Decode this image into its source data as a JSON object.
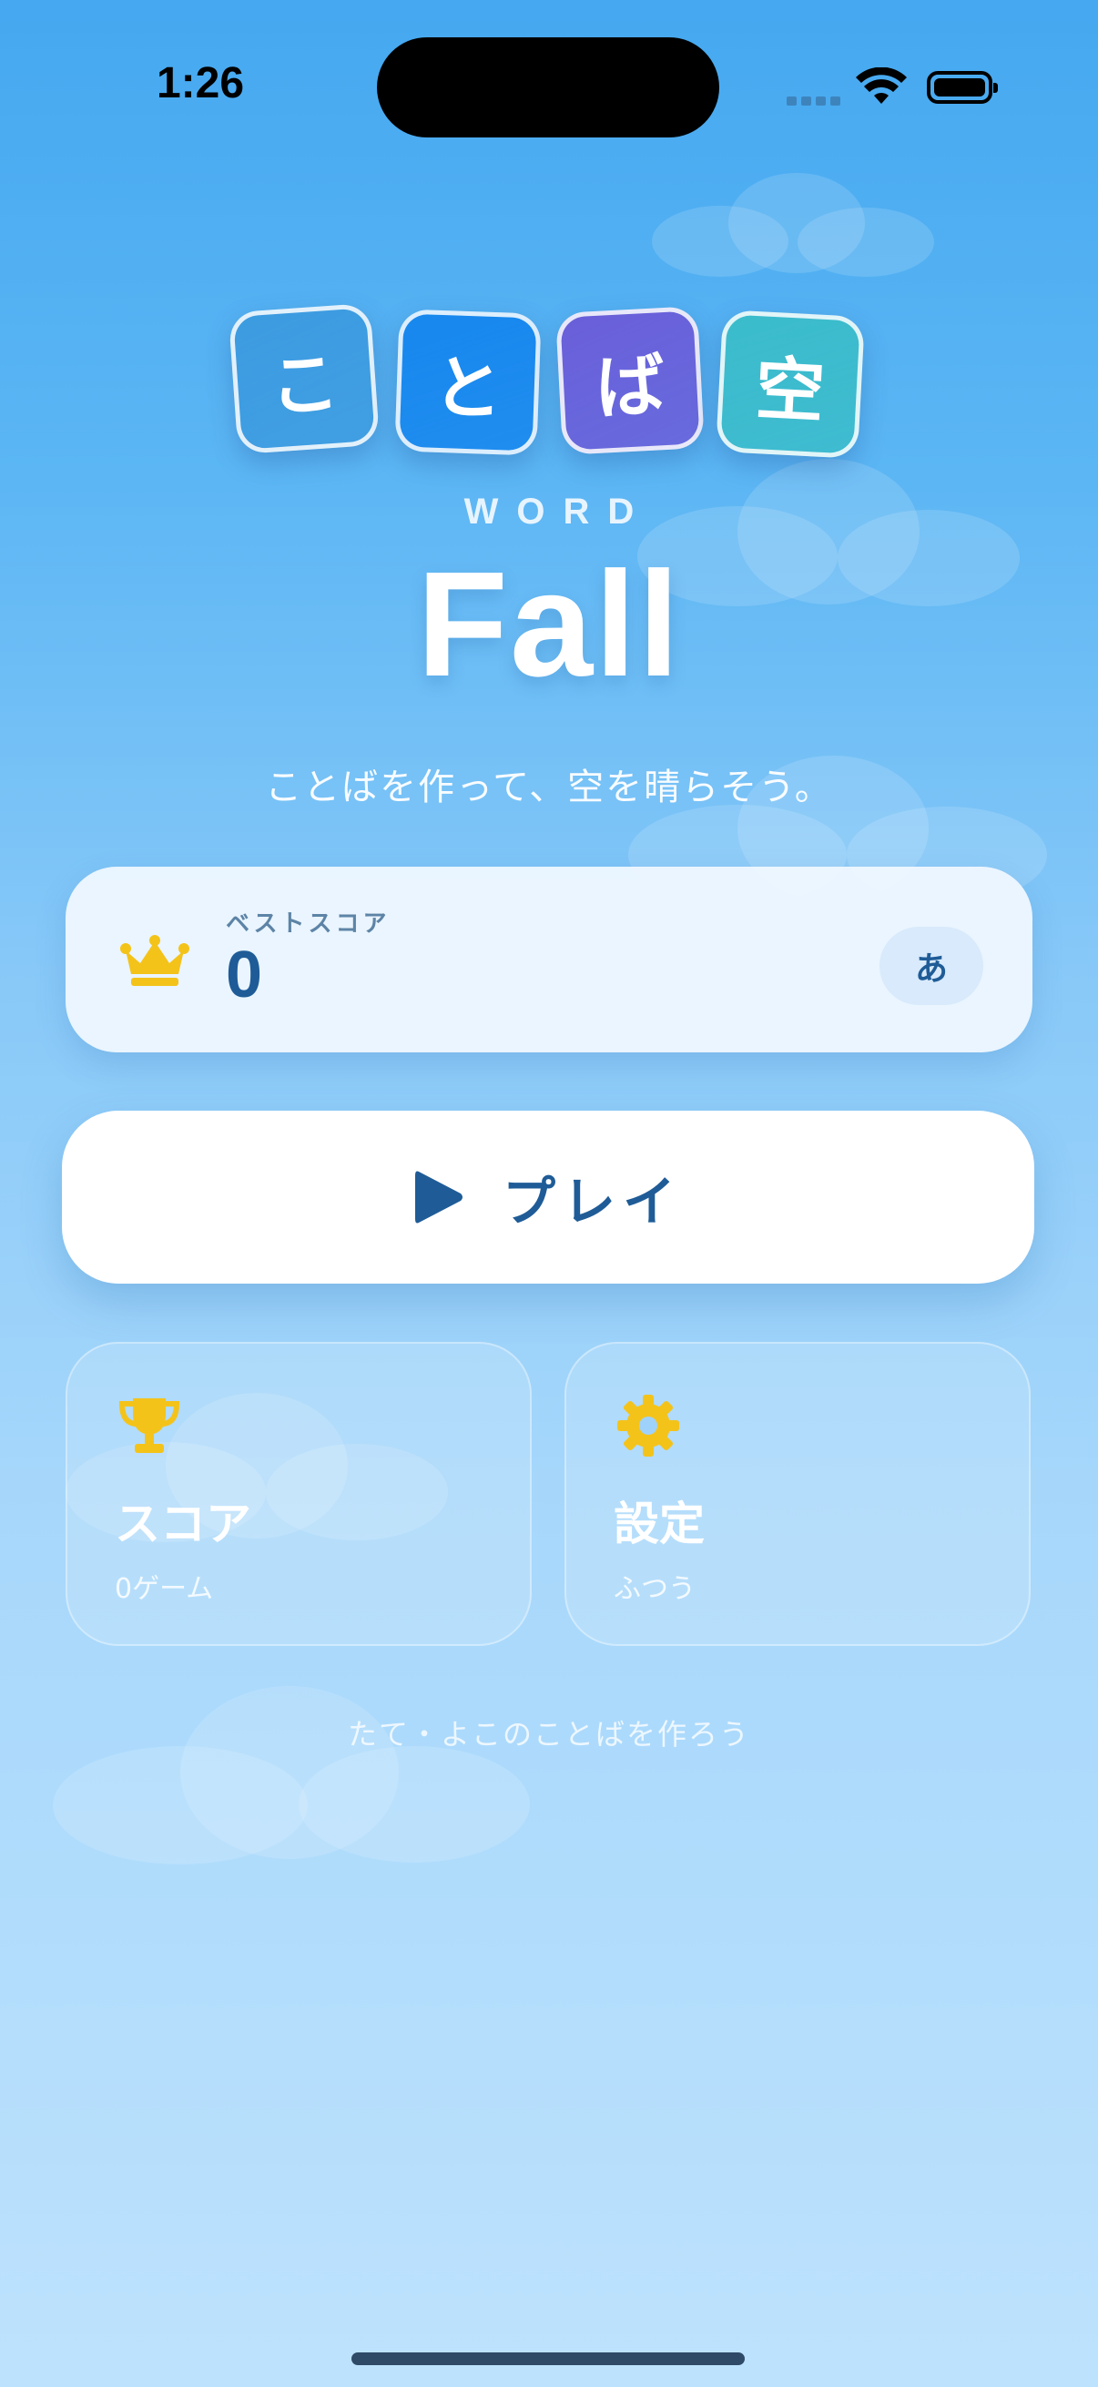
{
  "status_bar": {
    "time": "1:26"
  },
  "logo": {
    "tiles": [
      {
        "char": "こ",
        "color": "#3d9be0"
      },
      {
        "char": "と",
        "color": "#1787ee"
      },
      {
        "char": "ば",
        "color": "#6a5fd9"
      },
      {
        "char": "空",
        "color": "#3bbccb"
      }
    ],
    "word": "WORD",
    "title": "Fall"
  },
  "tagline": "ことばを作って、空を晴らそう。",
  "best_score": {
    "label": "ベストスコア",
    "value": "0",
    "icon": "crown-icon",
    "kana_button": "あ"
  },
  "play_button": {
    "label": "プレイ",
    "icon": "play-icon"
  },
  "cards": {
    "score": {
      "title": "スコア",
      "subtitle": "0ゲーム",
      "icon": "trophy-icon"
    },
    "settings": {
      "title": "設定",
      "subtitle": "ふつう",
      "icon": "gear-icon"
    }
  },
  "hint": "たて・よこのことばを作ろう",
  "colors": {
    "accent": "#1f5c97",
    "gold": "#f4c31a",
    "sky_top": "#45a8f0",
    "sky_bottom": "#bde2fd"
  }
}
